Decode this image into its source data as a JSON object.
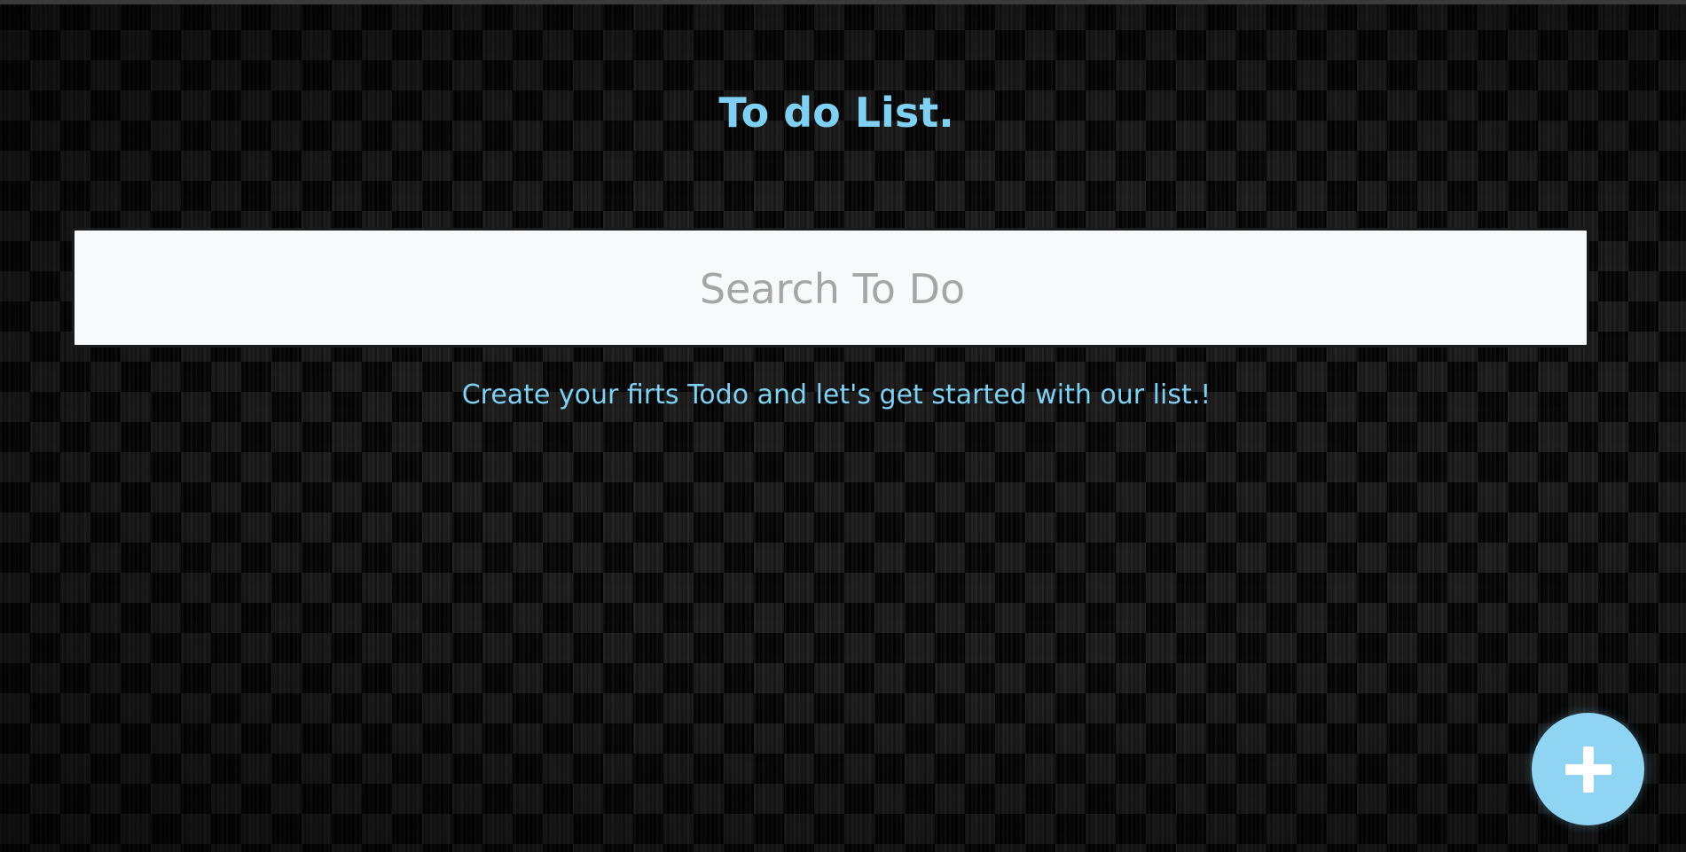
{
  "header": {
    "title": "To do List."
  },
  "search": {
    "placeholder": "Search To Do",
    "value": ""
  },
  "empty_state": {
    "message": "Create your firts Todo and let's get started with our list.!"
  },
  "fab": {
    "icon": "plus-icon"
  },
  "colors": {
    "accent": "#7fd0f2",
    "input_background": "#f8f9fb",
    "placeholder": "#a6a6a6"
  }
}
